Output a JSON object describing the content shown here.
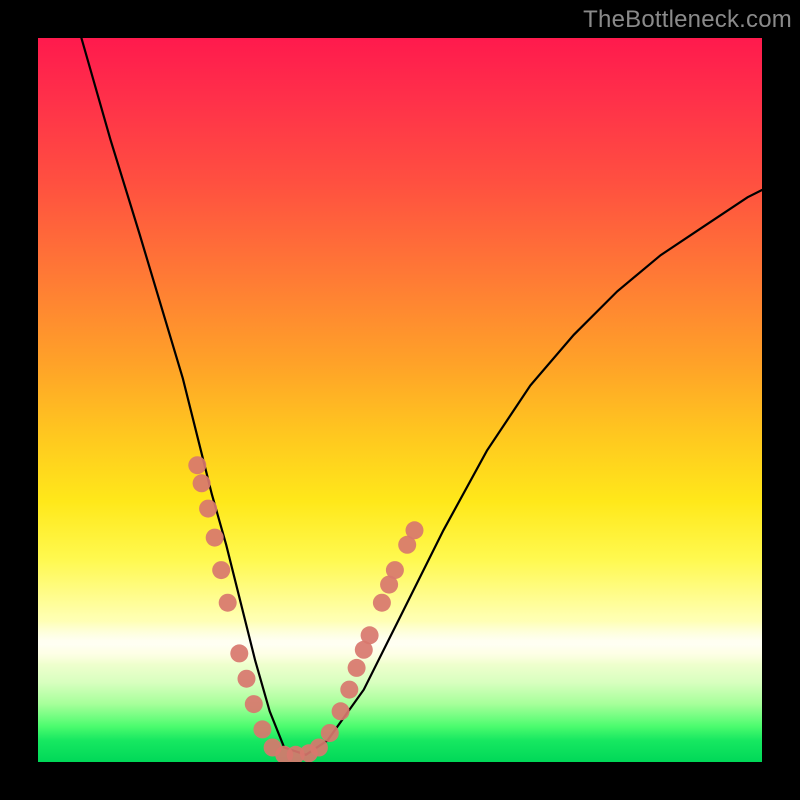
{
  "watermark": "TheBottleneck.com",
  "chart_data": {
    "type": "line",
    "title": "",
    "xlabel": "",
    "ylabel": "",
    "xlim": [
      0,
      100
    ],
    "ylim": [
      0,
      100
    ],
    "grid": false,
    "legend": false,
    "series": [
      {
        "name": "bottleneck-curve",
        "x": [
          6,
          10,
          14,
          17,
          20,
          22,
          24,
          26,
          28,
          30,
          32,
          34,
          37,
          40,
          45,
          50,
          56,
          62,
          68,
          74,
          80,
          86,
          92,
          98,
          100
        ],
        "y": [
          100,
          86,
          73,
          63,
          53,
          45,
          37,
          30,
          22,
          14,
          7,
          2,
          1,
          3,
          10,
          20,
          32,
          43,
          52,
          59,
          65,
          70,
          74,
          78,
          79
        ]
      }
    ],
    "highlight_points": {
      "name": "marker-cluster",
      "color": "#d8776e",
      "radius": 9,
      "points": [
        {
          "x": 22.0,
          "y": 41
        },
        {
          "x": 22.6,
          "y": 38.5
        },
        {
          "x": 23.5,
          "y": 35
        },
        {
          "x": 24.4,
          "y": 31
        },
        {
          "x": 25.3,
          "y": 26.5
        },
        {
          "x": 26.2,
          "y": 22
        },
        {
          "x": 27.8,
          "y": 15
        },
        {
          "x": 28.8,
          "y": 11.5
        },
        {
          "x": 29.8,
          "y": 8
        },
        {
          "x": 31.0,
          "y": 4.5
        },
        {
          "x": 32.4,
          "y": 2
        },
        {
          "x": 34.0,
          "y": 1
        },
        {
          "x": 35.6,
          "y": 1
        },
        {
          "x": 37.4,
          "y": 1.2
        },
        {
          "x": 38.8,
          "y": 2
        },
        {
          "x": 40.3,
          "y": 4
        },
        {
          "x": 41.8,
          "y": 7
        },
        {
          "x": 43.0,
          "y": 10
        },
        {
          "x": 44.0,
          "y": 13
        },
        {
          "x": 45.0,
          "y": 15.5
        },
        {
          "x": 45.8,
          "y": 17.5
        },
        {
          "x": 47.5,
          "y": 22
        },
        {
          "x": 48.5,
          "y": 24.5
        },
        {
          "x": 49.3,
          "y": 26.5
        },
        {
          "x": 51.0,
          "y": 30
        },
        {
          "x": 52.0,
          "y": 32
        }
      ]
    }
  }
}
